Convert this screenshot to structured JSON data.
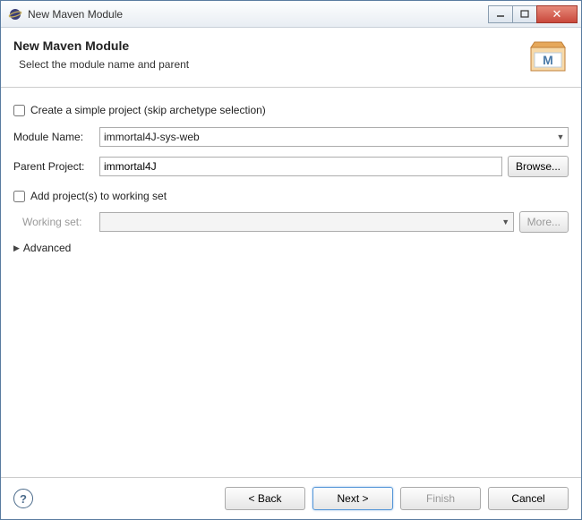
{
  "window": {
    "title": "New Maven Module"
  },
  "header": {
    "title": "New Maven Module",
    "subtitle": "Select the module name and parent"
  },
  "form": {
    "simple_project_label": "Create a simple project (skip archetype selection)",
    "module_name_label": "Module Name:",
    "module_name_value": "immortal4J-sys-web",
    "parent_project_label": "Parent Project:",
    "parent_project_value": "immortal4J",
    "browse_label": "Browse...",
    "add_working_set_label": "Add project(s) to working set",
    "working_set_label": "Working set:",
    "more_label": "More...",
    "advanced_label": "Advanced"
  },
  "footer": {
    "back_label": "< Back",
    "next_label": "Next >",
    "finish_label": "Finish",
    "cancel_label": "Cancel"
  }
}
